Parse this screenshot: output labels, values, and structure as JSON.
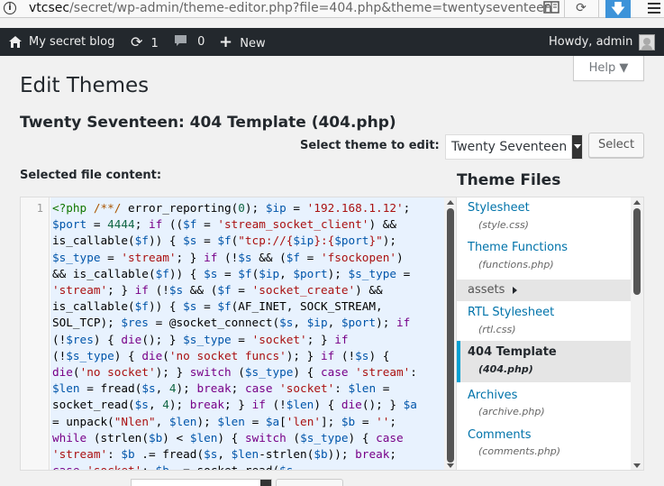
{
  "browser": {
    "url_host": "vtcsec",
    "url_path": "/secret/wp-admin/theme-editor.php?file=404.php&theme=twentyseventeen"
  },
  "adminbar": {
    "site_name": "My secret blog",
    "updates_count": "1",
    "comments_count": "0",
    "new_label": "New",
    "howdy": "Howdy, admin"
  },
  "help_label": "Help ▼",
  "page_title": "Edit Themes",
  "file_title": "Twenty Seventeen: 404 Template (404.php)",
  "theme_select": {
    "label": "Select theme to edit:",
    "value": "Twenty Seventeen",
    "button": "Select"
  },
  "content_label": "Selected file content:",
  "editor": {
    "line_number": "1"
  },
  "files": {
    "heading": "Theme Files",
    "items": [
      {
        "name": "Stylesheet",
        "file": "(style.css)"
      },
      {
        "name": "Theme Functions",
        "file": "(functions.php)"
      },
      {
        "name": "assets"
      },
      {
        "name": "RTL Stylesheet",
        "file": "(rtl.css)"
      },
      {
        "name": "404 Template",
        "file": "(404.php)"
      },
      {
        "name": "Archives",
        "file": "(archive.php)"
      },
      {
        "name": "Comments",
        "file": "(comments.php)"
      }
    ]
  },
  "colors": {
    "adminbar_bg": "#23282d",
    "link": "#0073aa",
    "active_border": "#00a0d2",
    "editor_bg": "#e8f2fe"
  }
}
